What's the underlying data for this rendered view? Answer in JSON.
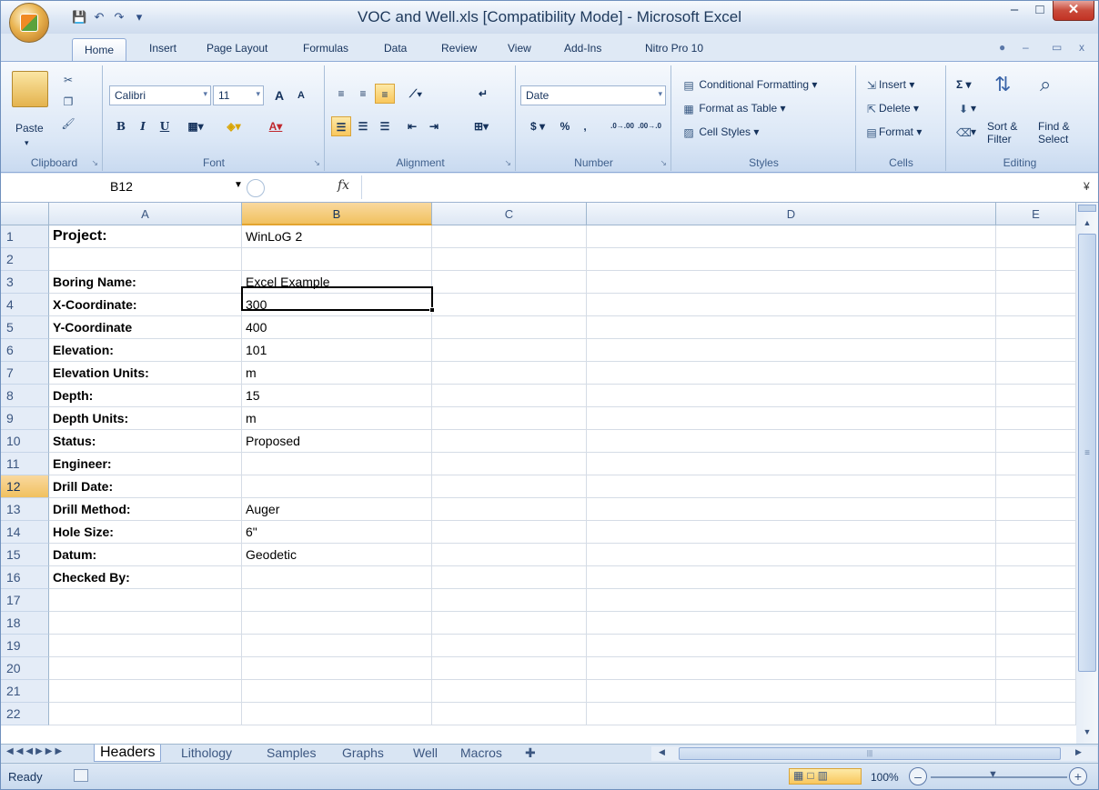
{
  "window": {
    "title": "VOC and Well.xls  [Compatibility Mode] - Microsoft Excel",
    "minimize": "–",
    "maximize": "□",
    "close": "✕"
  },
  "quick_access": {
    "save": "💾",
    "undo": "↶",
    "redo": "↷",
    "customize": "▾"
  },
  "tabs": [
    "Home",
    "Insert",
    "Page Layout",
    "Formulas",
    "Data",
    "Review",
    "View",
    "Add-Ins",
    "Nitro Pro 10"
  ],
  "active_tab": "Home",
  "ribbon": {
    "clipboard": {
      "label": "Clipboard",
      "paste": "Paste"
    },
    "font": {
      "label": "Font",
      "name": "Calibri",
      "size": "11",
      "bold": "B",
      "italic": "I",
      "underline": "U",
      "grow": "A",
      "shrink": "A"
    },
    "alignment": {
      "label": "Alignment"
    },
    "number": {
      "label": "Number",
      "format": "Date",
      "currency": "$",
      "percent": "%",
      "comma": ",",
      "inc_decimal": ".0→.00",
      "dec_decimal": ".00→.0"
    },
    "styles": {
      "label": "Styles",
      "conditional": "Conditional Formatting",
      "format_table": "Format as Table",
      "cell_styles": "Cell Styles"
    },
    "cells": {
      "label": "Cells",
      "insert": "Insert",
      "delete": "Delete",
      "format": "Format"
    },
    "editing": {
      "label": "Editing",
      "sort": "Sort &",
      "sort2": "Filter",
      "find": "Find &",
      "find2": "Select",
      "sum": "Σ"
    }
  },
  "formula_bar": {
    "name_box": "B12",
    "fx": "fx",
    "formula": ""
  },
  "columns": [
    "A",
    "B",
    "C",
    "D",
    "E"
  ],
  "selected_column": "B",
  "rows": [
    {
      "n": "1",
      "a": "Project:",
      "b": "WinLoG 2"
    },
    {
      "n": "2",
      "a": "",
      "b": ""
    },
    {
      "n": "3",
      "a": "Boring Name:",
      "b": "Excel Example"
    },
    {
      "n": "4",
      "a": "X-Coordinate:",
      "b": "300"
    },
    {
      "n": "5",
      "a": "Y-Coordinate",
      "b": "400"
    },
    {
      "n": "6",
      "a": "Elevation:",
      "b": "101"
    },
    {
      "n": "7",
      "a": "Elevation Units:",
      "b": "m"
    },
    {
      "n": "8",
      "a": "Depth:",
      "b": "15"
    },
    {
      "n": "9",
      "a": "Depth Units:",
      "b": "m"
    },
    {
      "n": "10",
      "a": "Status:",
      "b": "Proposed"
    },
    {
      "n": "11",
      "a": "Engineer:",
      "b": ""
    },
    {
      "n": "12",
      "a": "Drill Date:",
      "b": ""
    },
    {
      "n": "13",
      "a": "Drill Method:",
      "b": "Auger"
    },
    {
      "n": "14",
      "a": "Hole Size:",
      "b": "6\""
    },
    {
      "n": "15",
      "a": "Datum:",
      "b": "Geodetic"
    },
    {
      "n": "16",
      "a": "Checked By:",
      "b": ""
    },
    {
      "n": "17",
      "a": "",
      "b": ""
    },
    {
      "n": "18",
      "a": "",
      "b": ""
    },
    {
      "n": "19",
      "a": "",
      "b": ""
    },
    {
      "n": "20",
      "a": "",
      "b": ""
    },
    {
      "n": "21",
      "a": "",
      "b": ""
    },
    {
      "n": "22",
      "a": "",
      "b": ""
    }
  ],
  "selected_row": "12",
  "sheet_tabs": [
    "Headers",
    "Lithology",
    "Samples",
    "Graphs",
    "Well",
    "Macros"
  ],
  "active_sheet": "Headers",
  "status": {
    "text": "Ready",
    "zoom": "100%"
  }
}
